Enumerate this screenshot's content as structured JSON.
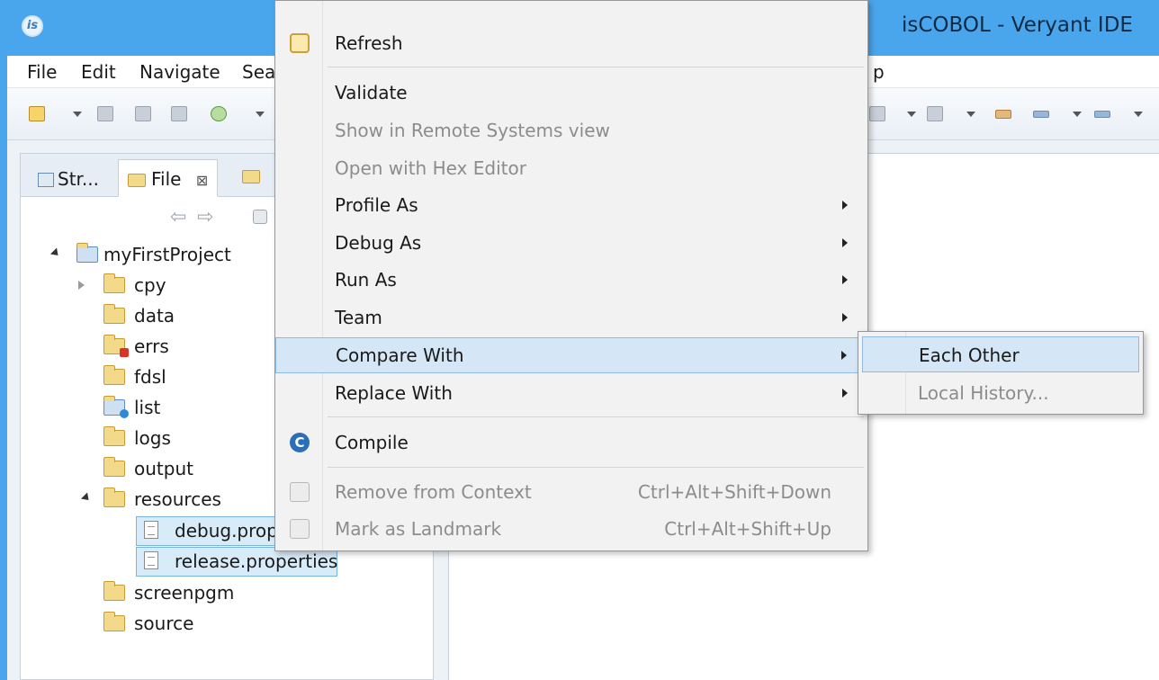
{
  "window": {
    "title": "isCOBOL - Veryant IDE",
    "logo_text": "is"
  },
  "menubar": {
    "items": [
      "File",
      "Edit",
      "Navigate",
      "Sea",
      "p"
    ]
  },
  "explorer": {
    "tabs": [
      {
        "label": "Str..."
      },
      {
        "label": "File",
        "close": "⊠"
      }
    ],
    "nav": {
      "back": "⇦",
      "forward": "⇨"
    },
    "tree": {
      "project": "myFirstProject",
      "folders": [
        {
          "label": "cpy"
        },
        {
          "label": "data"
        },
        {
          "label": "errs"
        },
        {
          "label": "fdsl"
        },
        {
          "label": "list"
        },
        {
          "label": "logs"
        },
        {
          "label": "output"
        },
        {
          "label": "resources"
        }
      ],
      "files": [
        {
          "label": "debug.prop"
        },
        {
          "label": "release.properties"
        }
      ],
      "more_folders": [
        {
          "label": "screenpgm"
        },
        {
          "label": "source"
        }
      ]
    }
  },
  "context_menu": {
    "items": [
      {
        "label": "Refresh",
        "icon": "refresh-icon"
      },
      {
        "label": "Validate"
      },
      {
        "label": "Show in Remote Systems view",
        "disabled": true
      },
      {
        "label": "Open with Hex Editor",
        "disabled": true
      },
      {
        "label": "Profile As",
        "submenu": true
      },
      {
        "label": "Debug As",
        "submenu": true
      },
      {
        "label": "Run As",
        "submenu": true
      },
      {
        "label": "Team",
        "submenu": true
      },
      {
        "label": "Compare With",
        "submenu": true,
        "highlighted": true
      },
      {
        "label": "Replace With",
        "submenu": true
      },
      {
        "label": "Compile",
        "icon": "compile-icon",
        "icon_letter": "C"
      },
      {
        "label": "Remove from Context",
        "shortcut": "Ctrl+Alt+Shift+Down",
        "disabled": true
      },
      {
        "label": "Mark as Landmark",
        "shortcut": "Ctrl+Alt+Shift+Up",
        "disabled": true
      }
    ]
  },
  "compare_submenu": {
    "items": [
      {
        "label": "Each Other",
        "highlighted": true
      },
      {
        "label": "Local History...",
        "disabled": true
      }
    ]
  },
  "colors": {
    "titlebar": "#4aa6ec",
    "menu_highlight": "#d5e6f6",
    "compile_icon": "#2a6fb8"
  }
}
